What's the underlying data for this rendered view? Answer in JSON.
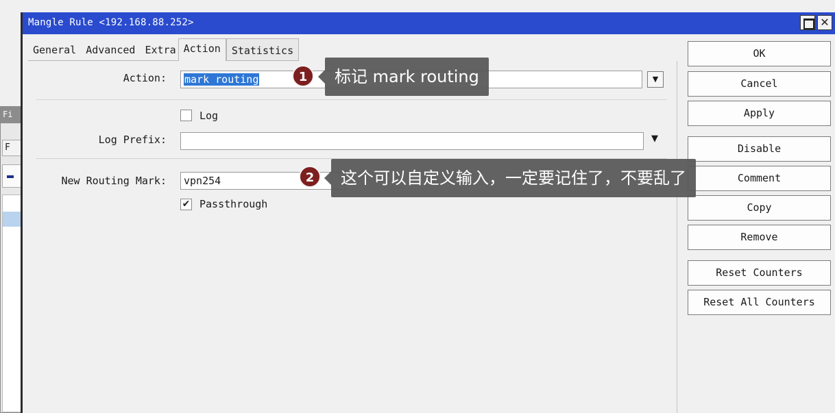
{
  "dialog": {
    "title": "Mangle Rule <192.168.88.252>",
    "tabs": [
      "General",
      "Advanced",
      "Extra",
      "Action",
      "Statistics"
    ],
    "active_tab": "Action"
  },
  "background_window": {
    "title": "Fi",
    "tab": "F"
  },
  "form": {
    "action_label": "Action:",
    "action_value": "mark routing",
    "log_label": "Log",
    "log_checked": false,
    "log_prefix_label": "Log Prefix:",
    "log_prefix_value": "",
    "routing_mark_label": "New Routing Mark:",
    "routing_mark_value": "vpn254",
    "passthrough_label": "Passthrough",
    "passthrough_checked": true
  },
  "buttons": [
    "OK",
    "Cancel",
    "Apply",
    "Disable",
    "Comment",
    "Copy",
    "Remove",
    "Reset Counters",
    "Reset All Counters"
  ],
  "callouts": [
    {
      "number": "1",
      "text": "标记 mark routing"
    },
    {
      "number": "2",
      "text": "这个可以自定义输入，一定要记住了，不要乱了"
    }
  ],
  "icons": {
    "dropdown": "dropdown-arrow-icon",
    "maximize": "maximize-icon",
    "close": "close-icon",
    "check": "checkmark-icon"
  }
}
